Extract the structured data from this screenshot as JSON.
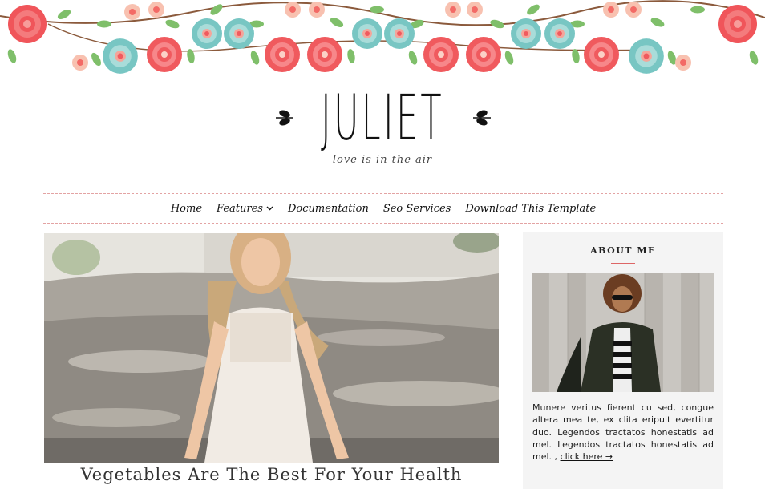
{
  "header": {
    "title": "JULIET",
    "tagline": "love is in the air"
  },
  "nav": {
    "items": [
      {
        "label": "Home"
      },
      {
        "label": "Features"
      },
      {
        "label": "Documentation"
      },
      {
        "label": "Seo Services"
      },
      {
        "label": "Download This Template"
      }
    ]
  },
  "post": {
    "title": "Vegetables Are The Best For Your Health"
  },
  "sidebar": {
    "about": {
      "heading": "ABOUT ME",
      "text": "Munere veritus fierent cu sed, congue altera mea te, ex clita eripuit evertitur duo. Legendos tractatos honestatis ad mel. Legendos tractatos honestatis ad mel. ,",
      "link_label": "click here →"
    }
  },
  "colors": {
    "accent": "#d66666",
    "flower_red": "#f0555a",
    "flower_teal": "#6fc0bd",
    "flower_pink": "#f7b9a6",
    "leaf_green": "#7fbf6a"
  }
}
